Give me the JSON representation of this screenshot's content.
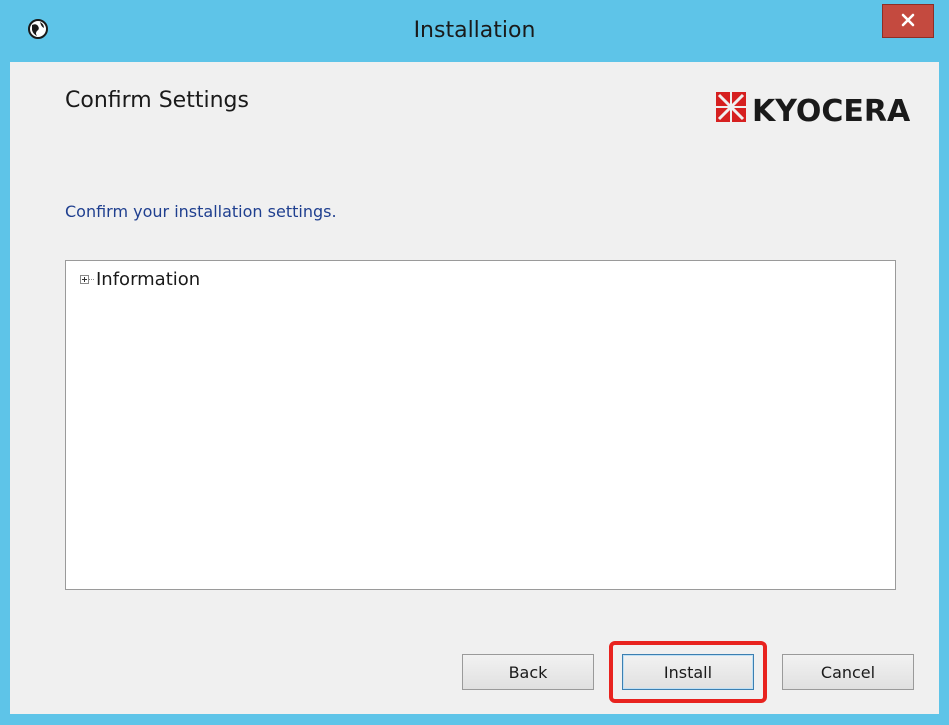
{
  "window": {
    "title": "Installation",
    "app_icon": "globe-icon",
    "close_icon": "close-icon"
  },
  "header": {
    "heading": "Confirm Settings",
    "logo_text": "KYOCERA",
    "brand_color": "#d62020"
  },
  "main": {
    "instruction": "Confirm your installation settings.",
    "instruction_color": "#1f3f8f",
    "tree": {
      "items": [
        {
          "label": "Information",
          "expanded": false
        }
      ]
    }
  },
  "footer": {
    "back_label": "Back",
    "install_label": "Install",
    "cancel_label": "Cancel",
    "highlight_color": "#e8231f"
  }
}
